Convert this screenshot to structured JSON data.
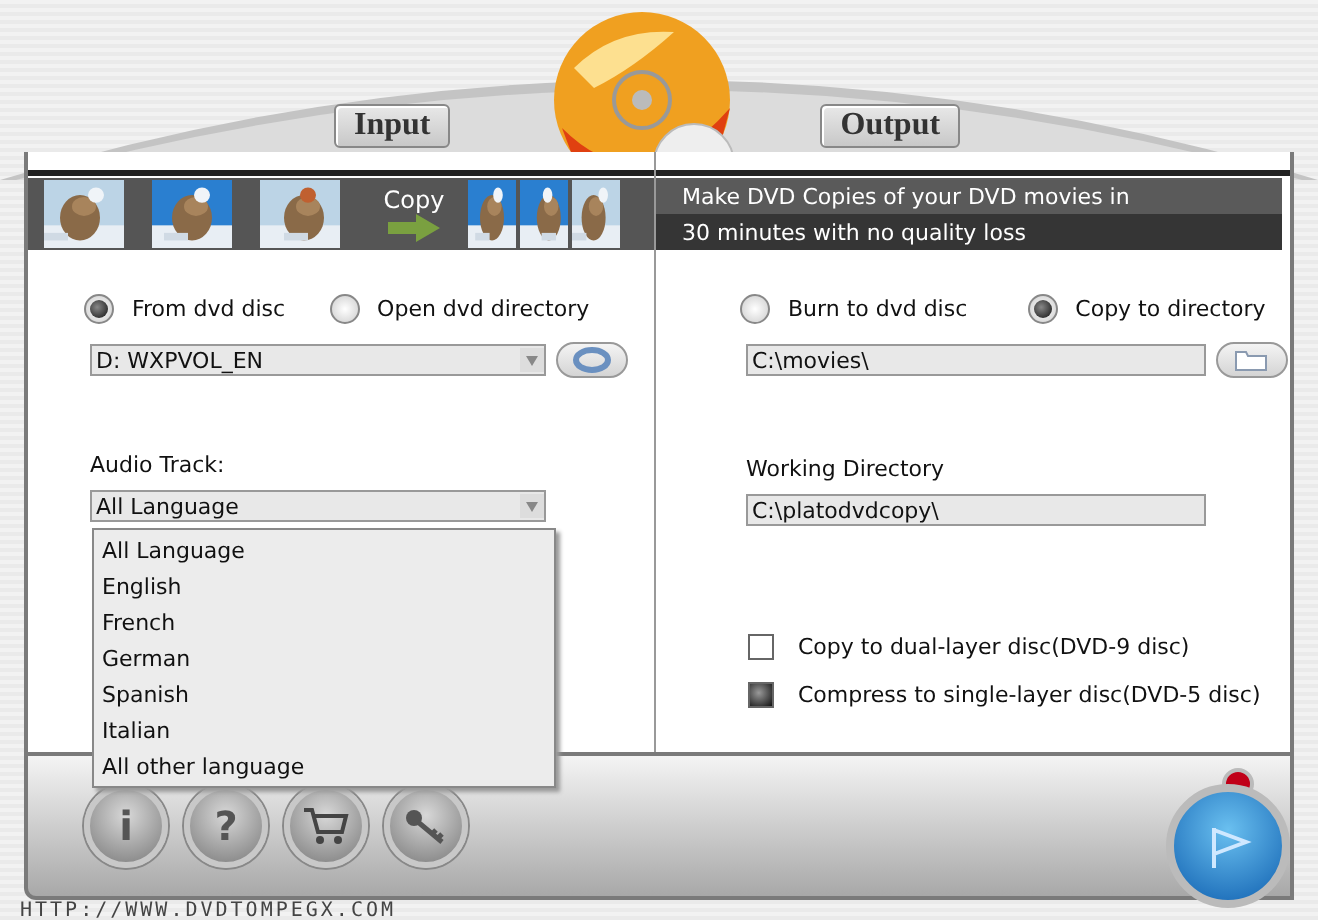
{
  "tabs": [
    {
      "label": "Input"
    },
    {
      "label": "Output"
    }
  ],
  "banner": {
    "copy_label": "Copy",
    "text_lines": [
      "Make DVD Copies of your DVD movies in",
      "30 minutes with no quality loss"
    ]
  },
  "input": {
    "source_options": [
      {
        "label": "From dvd disc",
        "selected": true
      },
      {
        "label": "Open dvd directory",
        "selected": false
      }
    ],
    "drive": {
      "value": "D: WXPVOL_EN"
    },
    "audio_label": "Audio Track:",
    "audio": {
      "value": "All Language",
      "expanded": true,
      "options": [
        "All Language",
        "English",
        "French",
        "German",
        "Spanish",
        "Italian",
        "All other language"
      ]
    }
  },
  "output": {
    "target_options": [
      {
        "label": "Burn to dvd disc",
        "selected": false
      },
      {
        "label": "Copy to directory",
        "selected": true
      }
    ],
    "target_path": "C:\\movies\\",
    "working_label": "Working Directory",
    "working_path": "C:\\platodvdcopy\\",
    "disc_options": [
      {
        "label": "Copy to dual-layer disc(DVD-9 disc)",
        "checked": false
      },
      {
        "label": "Compress to single-layer disc(DVD-5 disc)",
        "checked": true
      }
    ]
  },
  "toolbar": [
    {
      "kind": "info",
      "label": "i"
    },
    {
      "kind": "help",
      "label": "?"
    },
    {
      "kind": "cart"
    },
    {
      "kind": "key"
    }
  ],
  "footer_url": "HTTP://WWW.DVDTOMPEGX.COM"
}
